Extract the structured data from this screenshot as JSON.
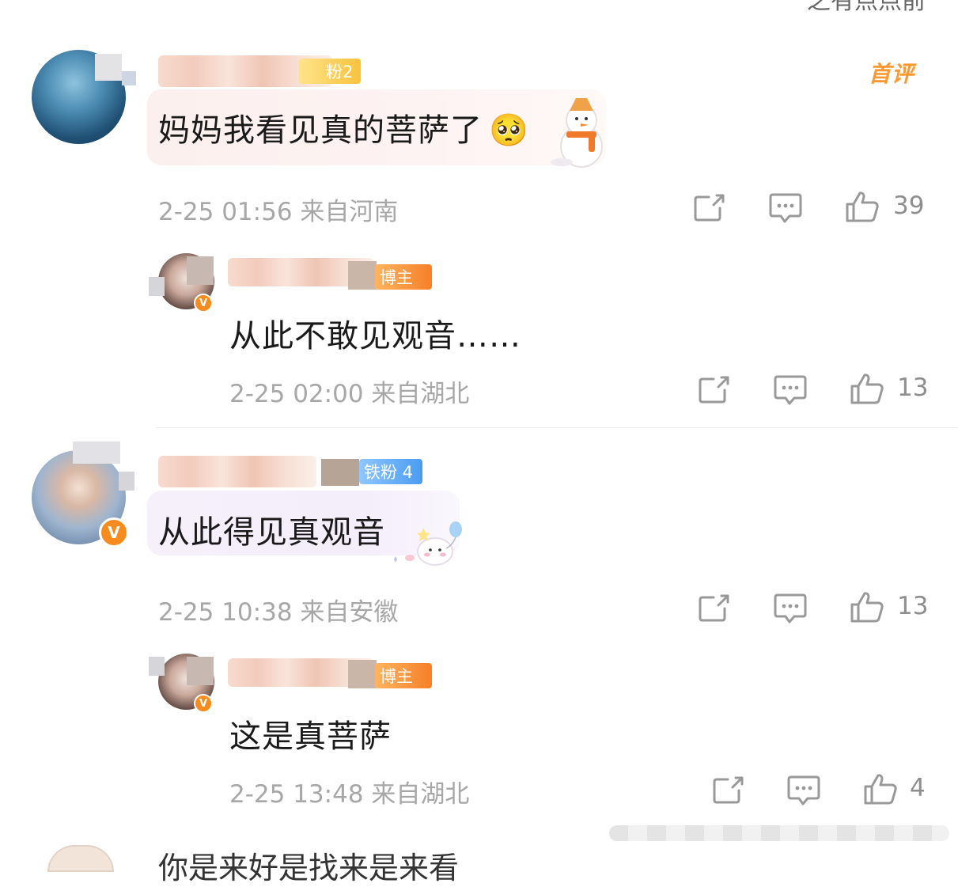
{
  "top": {
    "partial_text": "之有点点前"
  },
  "comments": [
    {
      "badge": "粉2",
      "first_tag": "首评",
      "text": "妈妈我看见真的菩萨了",
      "emoji": "🥺",
      "date": "2-25 01:56",
      "location": "来自河南",
      "likes": "39"
    },
    {
      "badge": "博主",
      "text": "从此不敢见观音……",
      "date": "2-25 02:00",
      "location": "来自湖北",
      "likes": "13"
    },
    {
      "badge": "铁粉 4",
      "text": "从此得见真观音",
      "date": "2-25 10:38",
      "location": "来自安徽",
      "likes": "13"
    },
    {
      "badge": "博主",
      "text": "这是真菩萨",
      "date": "2-25 13:48",
      "location": "来自湖北",
      "likes": "4"
    }
  ],
  "bottom": {
    "partial_text": "你是来好是找来是来看"
  },
  "verified_mark": "V"
}
